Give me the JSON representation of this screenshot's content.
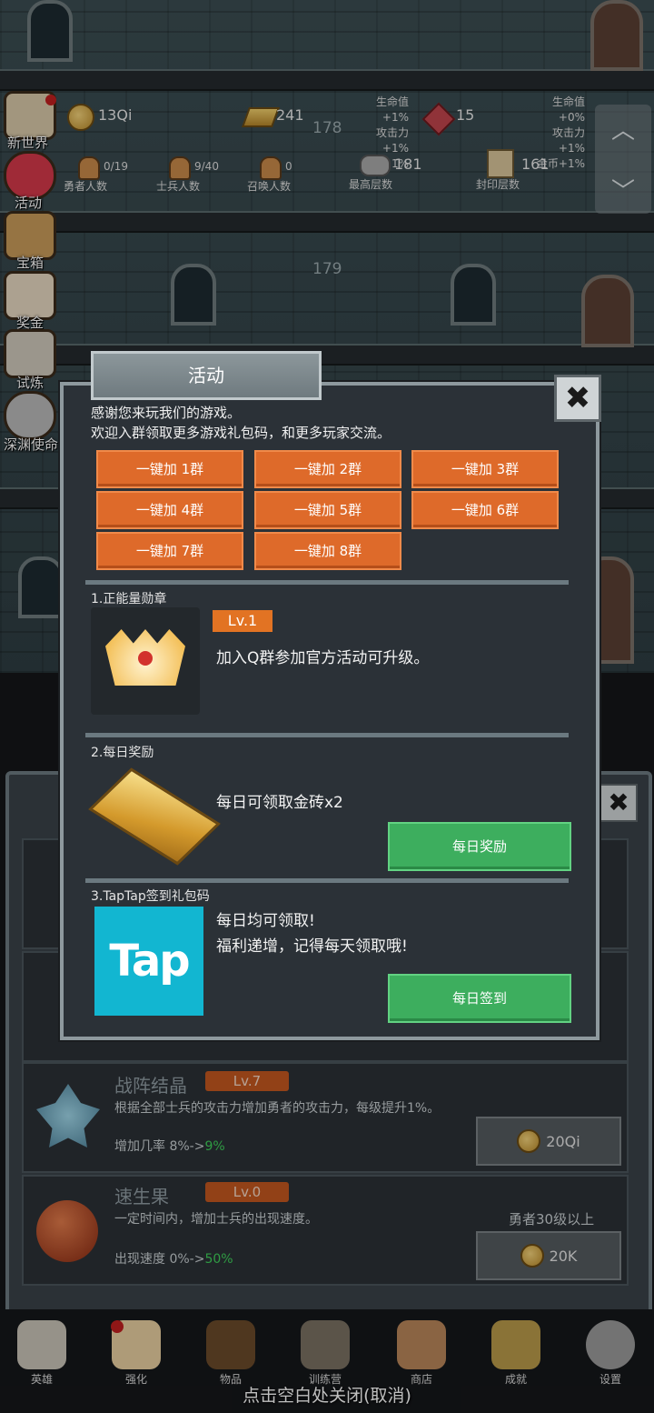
{
  "hud": {
    "coins": "13Qi",
    "gold_bars": "241",
    "gems": "15",
    "heroes_value": "0/19",
    "heroes_label": "勇者人数",
    "soldiers_value": "9/40",
    "soldiers_label": "士兵人数",
    "summons_value": "0",
    "summons_label": "召唤人数",
    "max_floor_value": "181",
    "max_floor_label": "最高层数",
    "seal_floor_value": "161",
    "seal_floor_label": "封印层数",
    "left_buff_1": "生命值+1%",
    "left_buff_2": "攻击力+1%",
    "left_buff_3": "金币+1%",
    "right_buff_1": "生命值+0%",
    "right_buff_2": "攻击力+1%",
    "right_buff_3": "金币+1%"
  },
  "floors": {
    "upper": "178",
    "lower": "179"
  },
  "sidebar": [
    "新世界",
    "活动",
    "宝箱",
    "奖金",
    "试炼",
    "深渊使命"
  ],
  "modal": {
    "tab_title": "活动",
    "intro_line1": "感谢您来玩我们的游戏。",
    "intro_line2": "欢迎入群领取更多游戏礼包码，和更多玩家交流。",
    "group_buttons": [
      "一键加 1群",
      "一键加 2群",
      "一键加 3群",
      "一键加 4群",
      "一键加 5群",
      "一键加 6群",
      "一键加 7群",
      "一键加 8群"
    ],
    "sec1_title": "1.正能量勋章",
    "sec1_level": "Lv.1",
    "sec1_text": "加入Q群参加官方活动可升级。",
    "sec2_title": "2.每日奖励",
    "sec2_text": "每日可领取金砖x2",
    "sec2_button": "每日奖励",
    "sec3_title": "3.TapTap签到礼包码",
    "sec3_logo": "Tap",
    "sec3_text1": "每日均可领取!",
    "sec3_text2": "福利递增，记得每天领取哦!",
    "sec3_button": "每日签到",
    "close_glyph": "✖"
  },
  "upgrades": [
    {
      "title": "战阵结晶",
      "level": "Lv.7",
      "desc": "根据全部士兵的攻击力增加勇者的攻击力，每级提升1%。",
      "stat_prefix": "增加几率 8%->",
      "stat_next": "9%",
      "cost": "20Qi"
    },
    {
      "title": "速生果",
      "level": "Lv.0",
      "desc": "一定时间内，增加士兵的出现速度。",
      "stat_prefix": "出现速度 0%->",
      "stat_next": "50%",
      "cost": "20K",
      "requirement": "勇者30级以上"
    }
  ],
  "nav": [
    "英雄",
    "强化",
    "物品",
    "训练营",
    "商店",
    "成就",
    "设置"
  ],
  "close_hint": "点击空白处关闭(取消)",
  "colors": {
    "orange": "#de6a2a",
    "green": "#3dae5e",
    "tap_blue": "#12b6d1"
  }
}
